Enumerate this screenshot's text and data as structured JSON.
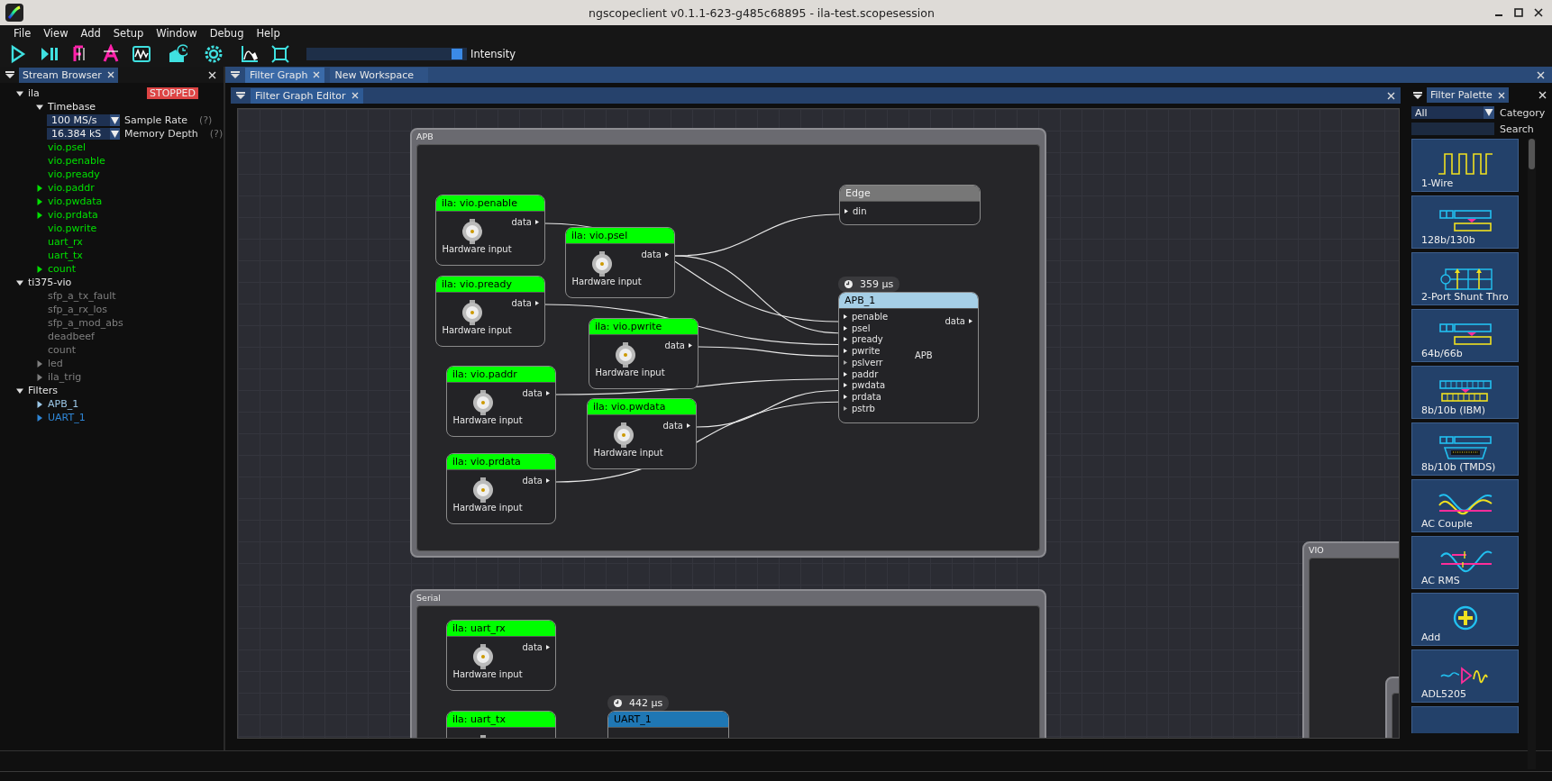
{
  "window": {
    "title": "ngscopeclient v0.1.1-623-g485c68895  - ila-test.scopesession"
  },
  "menu": [
    "File",
    "View",
    "Add",
    "Setup",
    "Window",
    "Debug",
    "Help"
  ],
  "toolbar": {
    "intensity": {
      "label": "Intensity",
      "level": 0.97
    }
  },
  "stream_browser": {
    "tab": "Stream Browser",
    "tree": [
      {
        "label": "ila",
        "expanded": true,
        "status": "STOPPED",
        "children": [
          {
            "label": "Timebase",
            "expanded": true,
            "children": [
              {
                "kind": "dropdown",
                "value": "100 MS/s",
                "label": "Sample Rate",
                "help": "(?)"
              },
              {
                "kind": "dropdown",
                "value": "16.384 kS",
                "label": "Memory Depth",
                "help": "(?)"
              }
            ]
          },
          {
            "label": "vio.psel",
            "color": "#00e000"
          },
          {
            "label": "vio.penable",
            "color": "#00e000"
          },
          {
            "label": "vio.pready",
            "color": "#00e000"
          },
          {
            "label": "vio.paddr",
            "color": "#00e000",
            "expanded": false
          },
          {
            "label": "vio.pwdata",
            "color": "#00e000",
            "expanded": false
          },
          {
            "label": "vio.prdata",
            "color": "#00e000",
            "expanded": false
          },
          {
            "label": "vio.pwrite",
            "color": "#00e000"
          },
          {
            "label": "uart_rx",
            "color": "#00e000"
          },
          {
            "label": "uart_tx",
            "color": "#00e000"
          },
          {
            "label": "count",
            "color": "#00e000",
            "expanded": false
          }
        ]
      },
      {
        "label": "ti375-vio",
        "expanded": true,
        "children": [
          {
            "label": "sfp_a_tx_fault",
            "color": "#7f7f7f"
          },
          {
            "label": "sfp_a_rx_los",
            "color": "#7f7f7f"
          },
          {
            "label": "sfp_a_mod_abs",
            "color": "#7f7f7f"
          },
          {
            "label": "deadbeef",
            "color": "#7f7f7f"
          },
          {
            "label": "count",
            "color": "#7f7f7f"
          },
          {
            "label": "led",
            "color": "#7f7f7f",
            "expanded": false
          },
          {
            "label": "ila_trig",
            "color": "#7f7f7f",
            "expanded": false
          }
        ]
      },
      {
        "label": "Filters",
        "expanded": true,
        "children": [
          {
            "label": "APB_1",
            "color": "#9cc8e8",
            "expanded": false
          },
          {
            "label": "UART_1",
            "color": "#2f86d6",
            "expanded": false
          }
        ]
      }
    ]
  },
  "tabs": [
    {
      "label": "Filter Graph",
      "selected": true
    },
    {
      "label": "New Workspace",
      "selected": false
    }
  ],
  "editor": {
    "tab": "Filter Graph Editor",
    "groups": [
      {
        "label": "APB"
      },
      {
        "label": "Serial"
      },
      {
        "label": "VIO"
      }
    ],
    "nodes": [
      {
        "kind": "hardware_input",
        "title": "ila: vio.penable",
        "color": "#00ff00",
        "caption": "Hardware input",
        "output": "data"
      },
      {
        "kind": "hardware_input",
        "title": "ila: vio.psel",
        "color": "#00ff00",
        "caption": "Hardware input",
        "output": "data"
      },
      {
        "kind": "hardware_input",
        "title": "ila: vio.pready",
        "color": "#00ff00",
        "caption": "Hardware input",
        "output": "data"
      },
      {
        "kind": "hardware_input",
        "title": "ila: vio.pwrite",
        "color": "#00ff00",
        "caption": "Hardware input",
        "output": "data"
      },
      {
        "kind": "hardware_input",
        "title": "ila: vio.paddr",
        "color": "#00ff00",
        "caption": "Hardware input",
        "output": "data"
      },
      {
        "kind": "hardware_input",
        "title": "ila: vio.pwdata",
        "color": "#00ff00",
        "caption": "Hardware input",
        "output": "data"
      },
      {
        "kind": "hardware_input",
        "title": "ila: vio.prdata",
        "color": "#00ff00",
        "caption": "Hardware input",
        "output": "data"
      },
      {
        "kind": "filter",
        "title": "Edge",
        "color": "#777777",
        "inputs": [
          {
            "name": "din",
            "connected": true
          }
        ]
      },
      {
        "kind": "filter",
        "title": "APB_1",
        "color": "#a6cfe6",
        "timing": "359 µs",
        "body": "APB",
        "output": "data",
        "inputs": [
          {
            "name": "penable",
            "connected": true
          },
          {
            "name": "psel",
            "connected": true
          },
          {
            "name": "pready",
            "connected": true
          },
          {
            "name": "pwrite",
            "connected": true
          },
          {
            "name": "pslverr",
            "connected": false
          },
          {
            "name": "paddr",
            "connected": true
          },
          {
            "name": "pwdata",
            "connected": true
          },
          {
            "name": "prdata",
            "connected": true
          },
          {
            "name": "pstrb",
            "connected": false
          }
        ]
      },
      {
        "kind": "hardware_input",
        "title": "ila: uart_rx",
        "color": "#00ff00",
        "caption": "Hardware input",
        "output": "data"
      },
      {
        "kind": "hardware_input",
        "title": "ila: uart_tx",
        "color": "#00ff00"
      },
      {
        "kind": "filter",
        "title": "UART_1",
        "color": "#1f77b4",
        "timing": "442 µs"
      }
    ]
  },
  "palette": {
    "tab": "Filter Palette",
    "category": {
      "value": "All",
      "label": "Category"
    },
    "search": {
      "label": "Search"
    },
    "items": [
      "1-Wire",
      "128b/130b",
      "2-Port Shunt Thro",
      "64b/66b",
      "8b/10b (IBM)",
      "8b/10b (TMDS)",
      "AC Couple",
      "AC RMS",
      "Add",
      "ADL5205"
    ]
  }
}
